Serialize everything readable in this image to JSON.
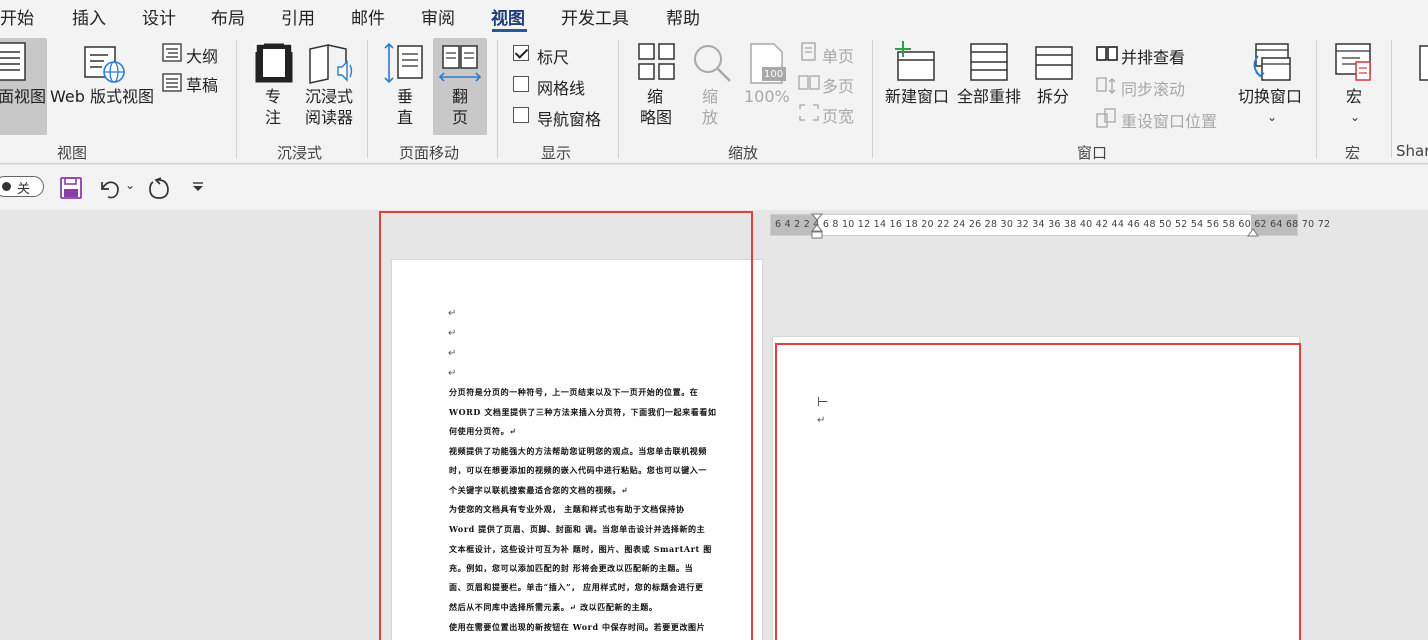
{
  "tabs": [
    {
      "label": "开始",
      "active": false
    },
    {
      "label": "插入",
      "active": false
    },
    {
      "label": "设计",
      "active": false
    },
    {
      "label": "布局",
      "active": false
    },
    {
      "label": "引用",
      "active": false
    },
    {
      "label": "邮件",
      "active": false
    },
    {
      "label": "审阅",
      "active": false
    },
    {
      "label": "视图",
      "active": true
    },
    {
      "label": "开发工具",
      "active": false
    },
    {
      "label": "帮助",
      "active": false
    }
  ],
  "ribbon": {
    "views": {
      "group_label": "视图",
      "print_layout": "面视图",
      "web_layout": "Web 版式视图",
      "outline": "大纲",
      "draft": "草稿"
    },
    "immersive": {
      "group_label": "沉浸式",
      "focus_1": "专",
      "focus_2": "注",
      "reader_1": "沉浸式",
      "reader_2": "阅读器"
    },
    "page_movement": {
      "group_label": "页面移动",
      "vertical_1": "垂",
      "vertical_2": "直",
      "side_1": "翻",
      "side_2": "页"
    },
    "show": {
      "group_label": "显示",
      "ruler": "标尺",
      "ruler_checked": true,
      "gridlines": "网格线",
      "gridlines_checked": false,
      "nav_pane": "导航窗格",
      "nav_pane_checked": false
    },
    "zoom": {
      "group_label": "缩放",
      "thumbnail_1": "缩",
      "thumbnail_2": "略图",
      "zoom_1": "缩",
      "zoom_2": "放",
      "hundred_icon_text": "100",
      "hundred": "100%",
      "one_page": "单页",
      "multi_page": "多页",
      "page_width": "页宽"
    },
    "window": {
      "group_label": "窗口",
      "new_window": "新建窗口",
      "arrange_all": "全部重排",
      "split": "拆分",
      "side_by_side": "并排查看",
      "sync_scroll": "同步滚动",
      "reset_position": "重设窗口位置",
      "switch_windows": "切换窗口"
    },
    "macros": {
      "group_label": "宏",
      "macro": "宏"
    },
    "share": {
      "group_label": "Shar"
    }
  },
  "qat": {
    "autosave_label": "关"
  },
  "ruler": {
    "numbers": "6  4  2        2  4  6  8  10 12 14 16 18 20 22 24 26 28 30 32 34 36 38 40 42 44 46 48 50 52 54 56 58 60 62 64      68 70 72"
  },
  "document": {
    "para_mark": "↵",
    "lines": [
      "分页符是分页的一种符号，上一页结束以及下一页开始的位置。在",
      "WORD 文档里提供了三种方法来插入分页符，下面我们一起来看看如",
      "何使用分页符。↵",
      "视频提供了功能强大的方法帮助您证明您的观点。当您单击联机视频",
      "时，可以在想要添加的视频的嵌入代码中进行粘贴。您也可以键入一",
      "个关键字以联机搜索最适合您的文档的视频。↵",
      "为使您的文档具有专业外观，    主题和样式也有助于文档保持协",
      "Word 提供了页眉、页脚、封面和    调。当您单击设计并选择新的主",
      "文本框设计，这些设计可互为补    题时，图片、图表或 SmartArt 图",
      "充。例如，您可以添加匹配的封    形将会更改以匹配新的主题。当",
      "面、页眉和提要栏。单击“插入”，   应用样式时，您的标题会进行更",
      "然后从不同库中选择所需元素。↵   改以匹配新的主题。",
      "使用在需要位置出现的新按钮在 Word 中保存时间。若要更改图片"
    ],
    "right_cursor": "⊢"
  }
}
